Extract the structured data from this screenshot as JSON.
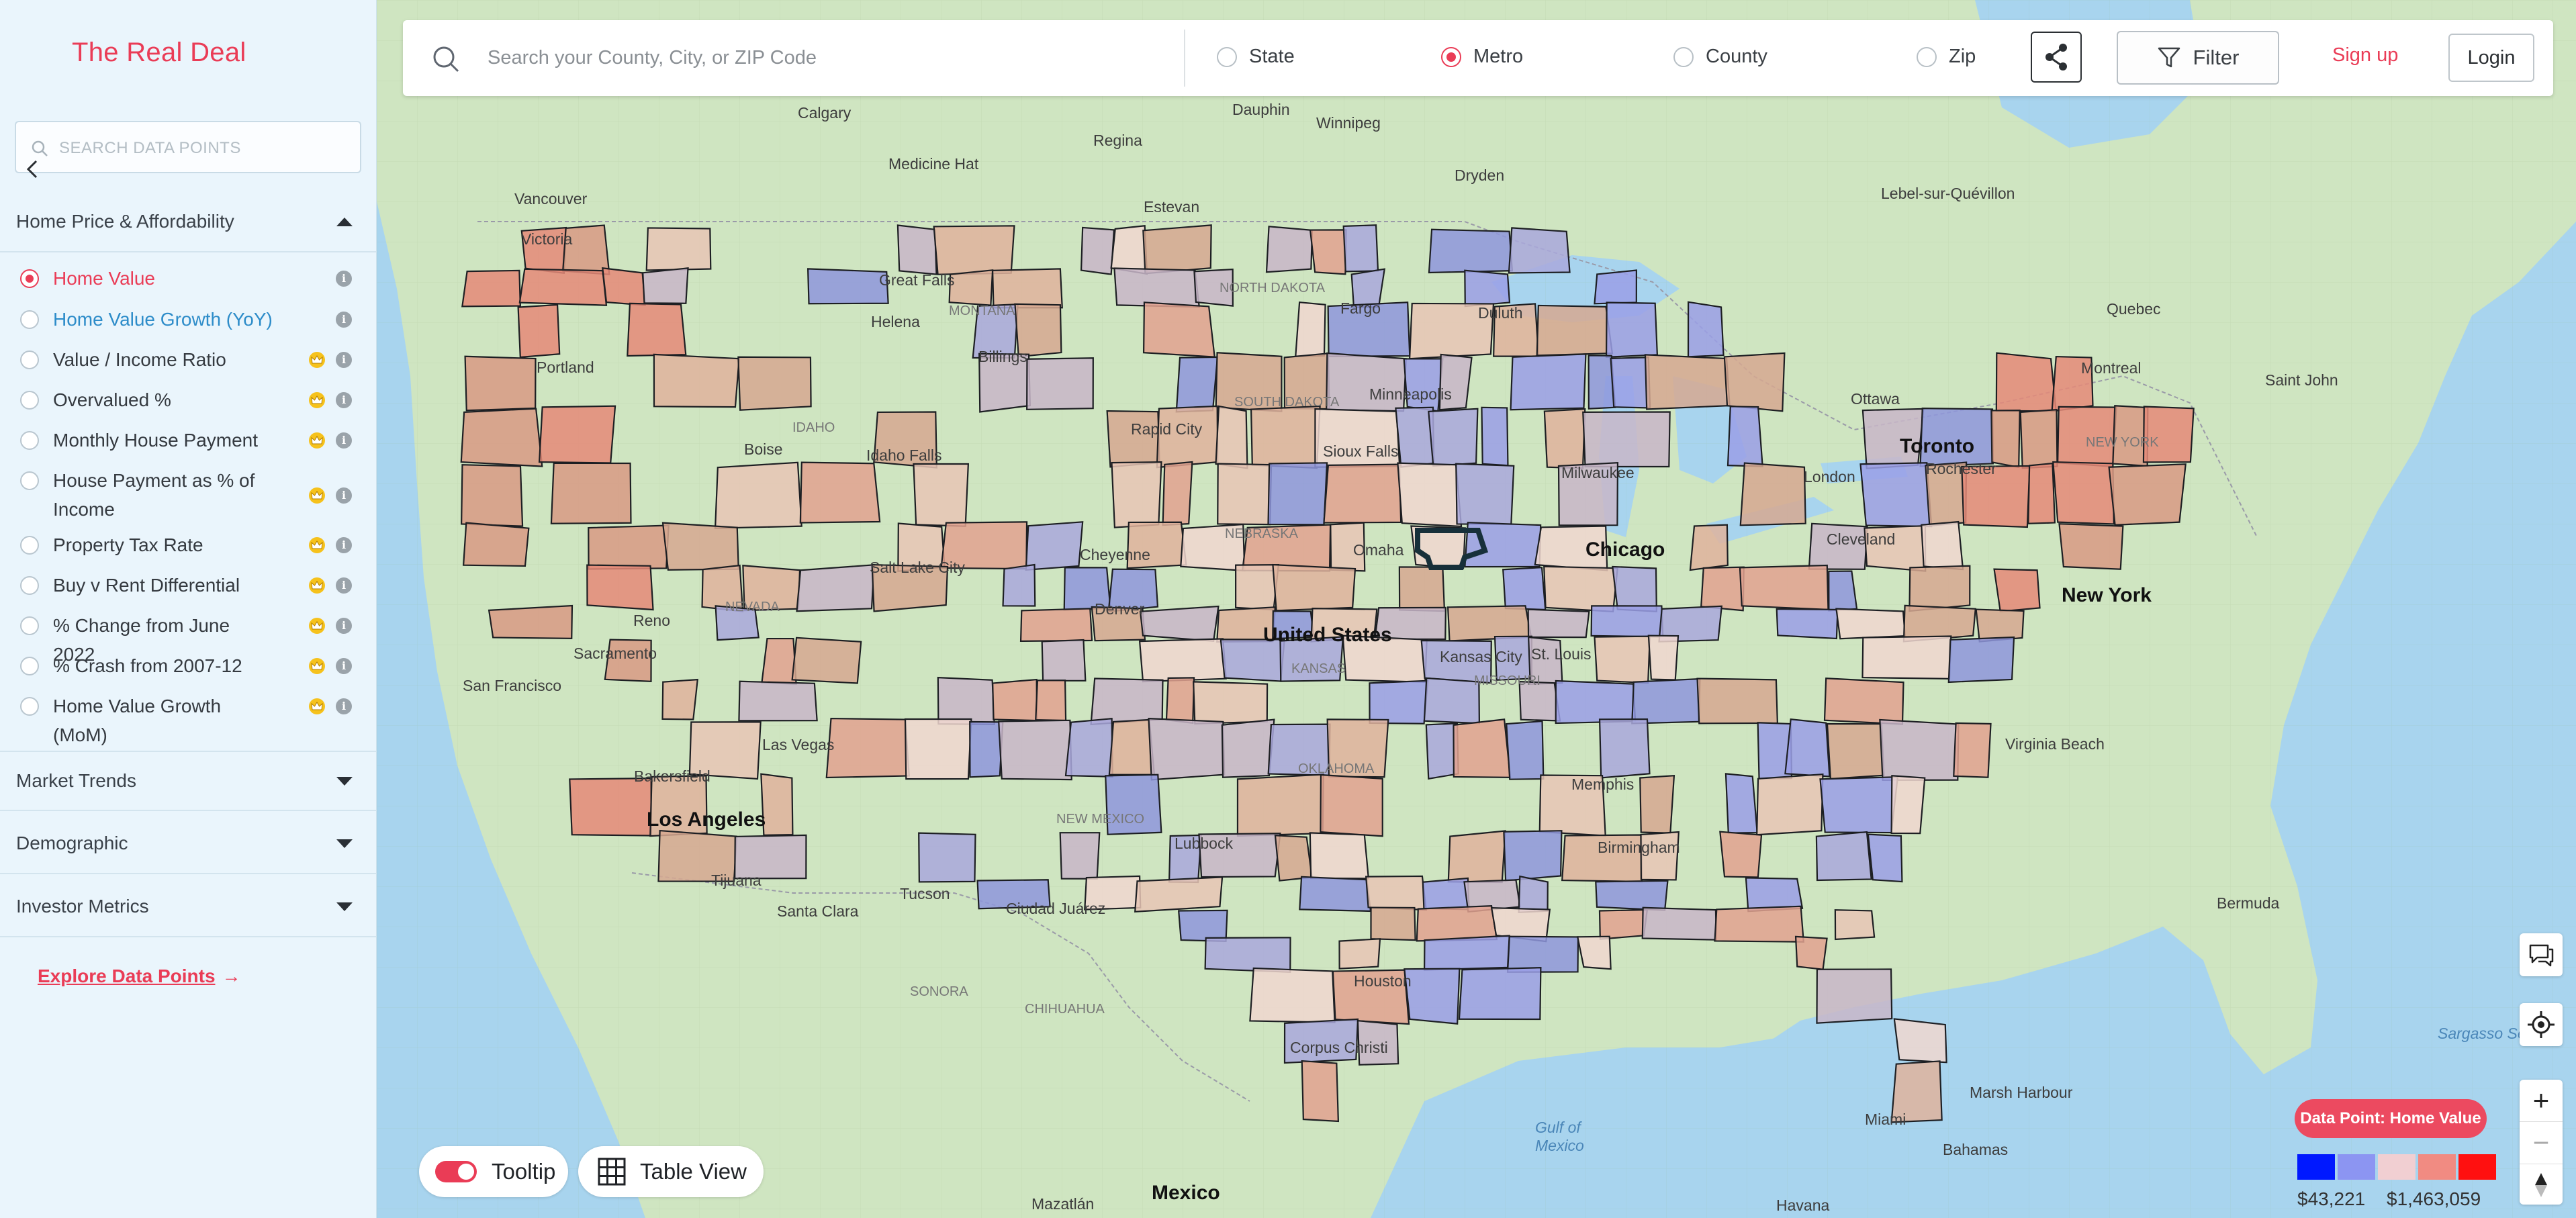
{
  "brand": "The Real Deal",
  "sidebar": {
    "search_placeholder": "SEARCH DATA POINTS",
    "sections": [
      {
        "label": "Home Price & Affordability",
        "expanded": true
      },
      {
        "label": "Market Trends",
        "expanded": false
      },
      {
        "label": "Demographic",
        "expanded": false
      },
      {
        "label": "Investor Metrics",
        "expanded": false
      }
    ],
    "data_points": [
      {
        "label": "Home Value",
        "selected": true,
        "premium": false
      },
      {
        "label": "Home Value Growth (YoY)",
        "selected": false,
        "premium": false
      },
      {
        "label": "Value / Income Ratio",
        "selected": false,
        "premium": true
      },
      {
        "label": "Overvalued %",
        "selected": false,
        "premium": true
      },
      {
        "label": "Monthly House Payment",
        "selected": false,
        "premium": true
      },
      {
        "label": "House Payment as % of Income",
        "selected": false,
        "premium": true
      },
      {
        "label": "Property Tax Rate",
        "selected": false,
        "premium": true
      },
      {
        "label": "Buy v Rent Differential",
        "selected": false,
        "premium": true
      },
      {
        "label": "% Change from June 2022",
        "selected": false,
        "premium": true
      },
      {
        "label": "% Crash from 2007-12",
        "selected": false,
        "premium": true
      },
      {
        "label": "Home Value Growth (MoM)",
        "selected": false,
        "premium": true
      }
    ],
    "explore_link": "Explore Data Points",
    "colors": {
      "accent": "#ea3c56",
      "link_blue": "#2d8cc9",
      "crown": "#f6c21c"
    }
  },
  "topbar": {
    "search_placeholder": "Search your County, City, or ZIP Code",
    "geo_options": [
      {
        "label": "State",
        "selected": false
      },
      {
        "label": "Metro",
        "selected": true
      },
      {
        "label": "County",
        "selected": false
      },
      {
        "label": "Zip",
        "selected": false
      }
    ],
    "filter_label": "Filter",
    "signup_label": "Sign up",
    "login_label": "Login"
  },
  "map": {
    "labels": [
      "Calgary",
      "Regina",
      "Winnipeg",
      "Vancouver",
      "Medicine Hat",
      "Estevan",
      "Dauphin",
      "Dryden",
      "Lebel-sur-Quévillon",
      "Victoria",
      "Great Falls",
      "Helena",
      "MONTANA",
      "Billings",
      "NORTH DAKOTA",
      "Fargo",
      "Duluth",
      "Minneapolis",
      "Portland",
      "Boise",
      "IDAHO",
      "Idaho Falls",
      "SOUTH DAKOTA",
      "Rapid City",
      "Sioux Falls",
      "Ottawa",
      "Montreal",
      "Quebec",
      "Toronto",
      "London",
      "Rochester",
      "Saint John",
      "NEW YORK",
      "Chicago",
      "Milwaukee",
      "Cleveland",
      "New York",
      "NEBRASKA",
      "Omaha",
      "Cheyenne",
      "Denver",
      "Salt Lake City",
      "NEVADA",
      "Reno",
      "Sacramento",
      "San Francisco",
      "United States",
      "KANSAS",
      "Kansas City",
      "MISSOURI",
      "St. Louis",
      "Las Vegas",
      "Los Angeles",
      "Bakersfield",
      "Tijuana",
      "Santa Clara",
      "Tucson",
      "Ciudad Juárez",
      "NEW MEXICO",
      "Lubbock",
      "OKLAHOMA",
      "Memphis",
      "Birmingham",
      "Virginia Beach",
      "Houston",
      "Corpus Christi",
      "SONORA",
      "CHIHUAHUA",
      "Mexico",
      "Mazatlán",
      "Havana",
      "Miami",
      "Bahamas",
      "Marsh Harbour",
      "Bermuda",
      "Gulf of Mexico",
      "Sargasso Sea"
    ],
    "tooltip_label": "Tooltip",
    "table_view_label": "Table View",
    "data_point_badge": "Data Point: Home Value",
    "legend": {
      "colors": [
        "#0018ff",
        "#8c95f2",
        "#f1cfd2",
        "#f18b82",
        "#ff1010"
      ],
      "min_label": "$43,221",
      "max_label": "$1,463,059"
    },
    "zoom_in": "+",
    "zoom_out": "−"
  }
}
